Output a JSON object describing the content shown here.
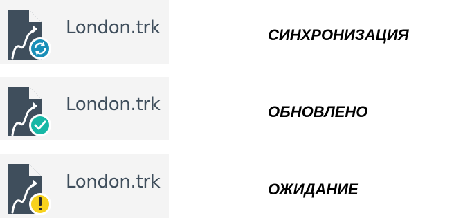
{
  "colors": {
    "icon_dark": "#3f4e5c",
    "entry_background": "#f4f4f4",
    "syncing_badge": "#1a8fb8",
    "updated_badge": "#17b8a6",
    "pending_badge": "#f7d21d",
    "label_text": "#000000"
  },
  "rows": [
    {
      "file_name": "London.trk",
      "status": "СИНХРОНИЗАЦИЯ",
      "badge_icon": "sync-icon"
    },
    {
      "file_name": "London.trk",
      "status": "ОБНОВЛЕНО",
      "badge_icon": "check-icon"
    },
    {
      "file_name": "London.trk",
      "status": "ОЖИДАНИЕ",
      "badge_icon": "exclamation-icon"
    }
  ]
}
